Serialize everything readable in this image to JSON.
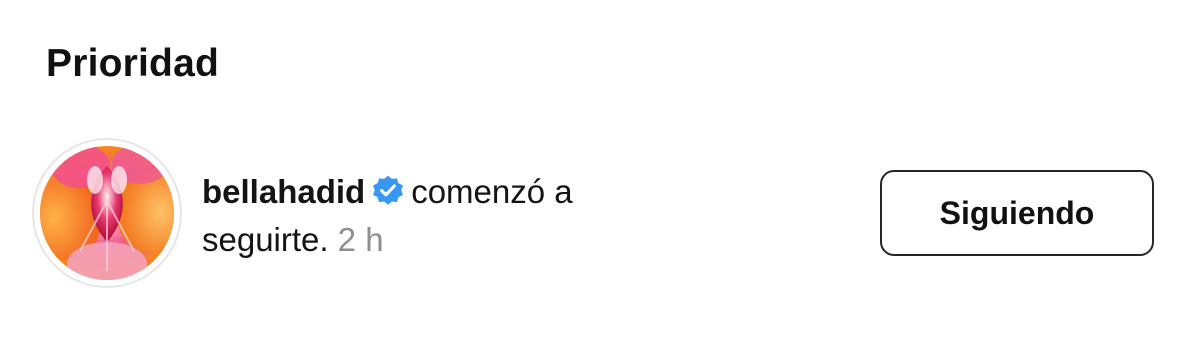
{
  "section": {
    "title": "Prioridad"
  },
  "notification": {
    "username": "bellahadid",
    "verified_icon": "verified-badge-icon",
    "verified_color": "#3897f0",
    "message": "comenzó a seguirte.",
    "time": "2 h",
    "avatar_icon": "profile-photo-avatar"
  },
  "action": {
    "button_label": "Siguiendo"
  }
}
